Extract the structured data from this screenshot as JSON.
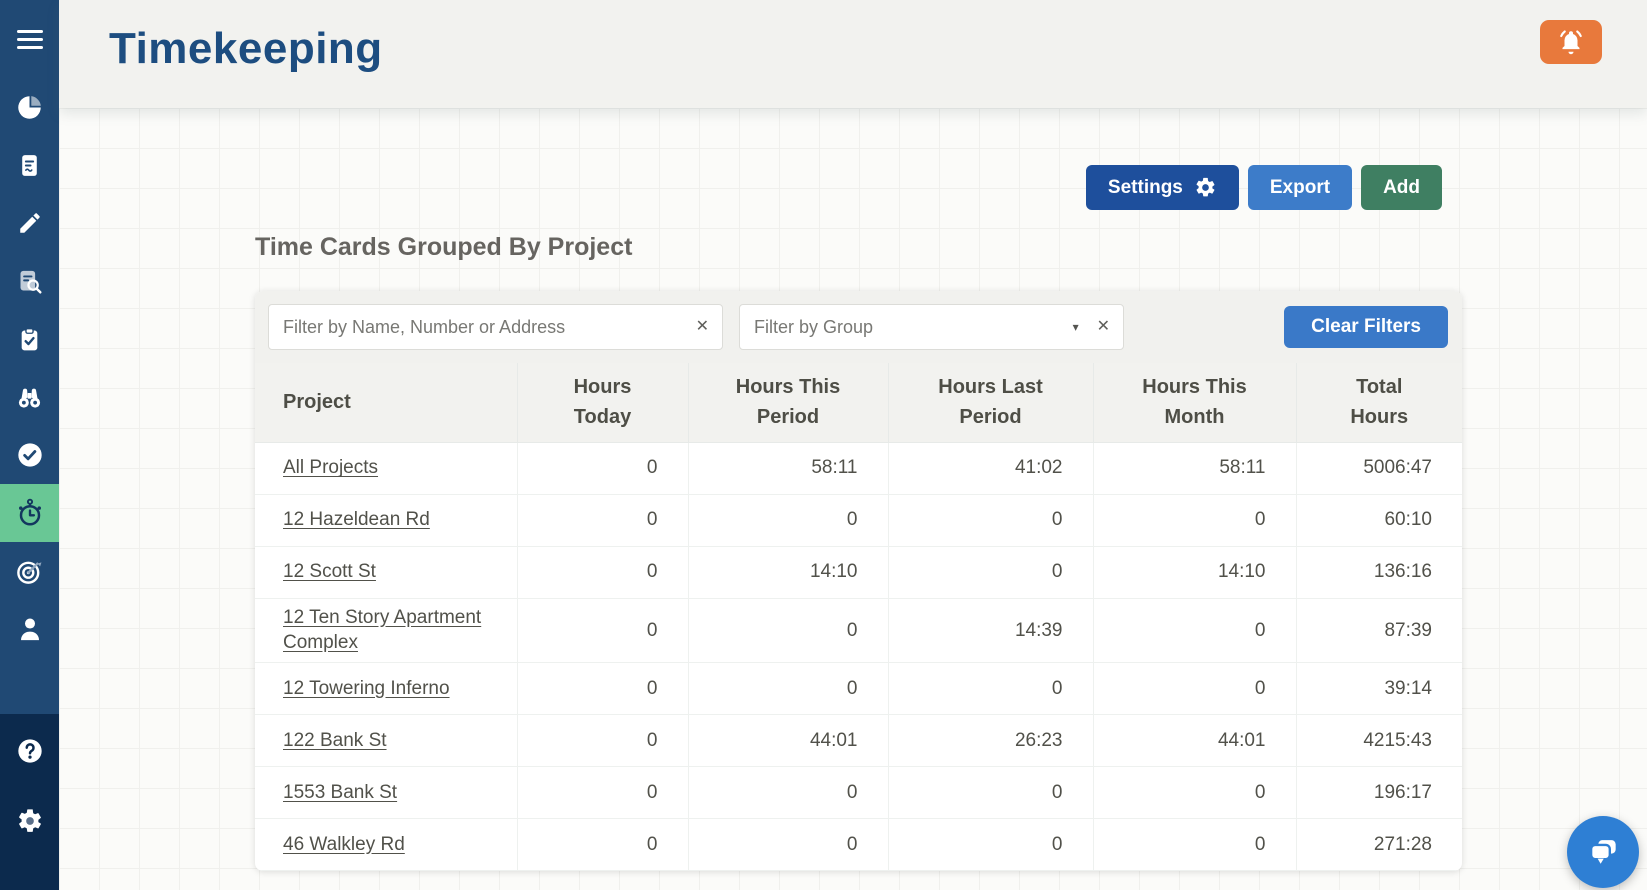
{
  "app": {
    "title": "Timekeeping"
  },
  "header": {
    "bell_icon": "bell-icon",
    "bell_color": "#e8793c"
  },
  "sidebar": {
    "background": "#204974",
    "bottom_background": "#0c2a4d",
    "active_background": "#69c795",
    "items": [
      {
        "icon": "hamburger-icon",
        "active": false
      },
      {
        "icon": "pie-chart-icon",
        "active": false
      },
      {
        "icon": "document-icon",
        "active": false
      },
      {
        "icon": "pencil-icon",
        "active": false
      },
      {
        "icon": "document-search-icon",
        "active": false
      },
      {
        "icon": "clipboard-check-icon",
        "active": false
      },
      {
        "icon": "binoculars-icon",
        "active": false
      },
      {
        "icon": "check-circle-icon",
        "active": false
      },
      {
        "icon": "stopwatch-icon",
        "active": true
      },
      {
        "icon": "target-icon",
        "active": false
      },
      {
        "icon": "person-icon",
        "active": false
      },
      {
        "icon": "help-icon",
        "active": false
      },
      {
        "icon": "gear-icon",
        "active": false
      }
    ]
  },
  "toolbar": {
    "settings_label": "Settings",
    "export_label": "Export",
    "add_label": "Add",
    "settings_color": "#1e4f9c",
    "export_color": "#3d7cc9",
    "add_color": "#3f7f62"
  },
  "page": {
    "title": "Time Cards Grouped By Project"
  },
  "filters": {
    "name_placeholder": "Filter by Name, Number or Address",
    "name_value": "",
    "group_placeholder": "Filter by Group",
    "group_value": "",
    "clear_button_label": "Clear Filters",
    "clear_button_color": "#3a79c8"
  },
  "icons": {
    "clear_x": "✕",
    "dropdown_arrow": "▾"
  },
  "table": {
    "columns": [
      {
        "l1": "Project",
        "l2": ""
      },
      {
        "l1": "Hours",
        "l2": "Today"
      },
      {
        "l1": "Hours This",
        "l2": "Period"
      },
      {
        "l1": "Hours Last",
        "l2": "Period"
      },
      {
        "l1": "Hours This",
        "l2": "Month"
      },
      {
        "l1": "Total",
        "l2": "Hours"
      }
    ],
    "rows": [
      {
        "project": "All Projects",
        "hours_today": "0",
        "hours_this_period": "58:11",
        "hours_last_period": "41:02",
        "hours_this_month": "58:11",
        "total_hours": "5006:47"
      },
      {
        "project": "12 Hazeldean Rd",
        "hours_today": "0",
        "hours_this_period": "0",
        "hours_last_period": "0",
        "hours_this_month": "0",
        "total_hours": "60:10"
      },
      {
        "project": "12 Scott St",
        "hours_today": "0",
        "hours_this_period": "14:10",
        "hours_last_period": "0",
        "hours_this_month": "14:10",
        "total_hours": "136:16"
      },
      {
        "project": "12 Ten Story Apartment Complex",
        "hours_today": "0",
        "hours_this_period": "0",
        "hours_last_period": "14:39",
        "hours_this_month": "0",
        "total_hours": "87:39"
      },
      {
        "project": "12 Towering Inferno",
        "hours_today": "0",
        "hours_this_period": "0",
        "hours_last_period": "0",
        "hours_this_month": "0",
        "total_hours": "39:14"
      },
      {
        "project": "122 Bank St",
        "hours_today": "0",
        "hours_this_period": "44:01",
        "hours_last_period": "26:23",
        "hours_this_month": "44:01",
        "total_hours": "4215:43"
      },
      {
        "project": "1553 Bank St",
        "hours_today": "0",
        "hours_this_period": "0",
        "hours_last_period": "0",
        "hours_this_month": "0",
        "total_hours": "196:17"
      },
      {
        "project": "46 Walkley Rd",
        "hours_today": "0",
        "hours_this_period": "0",
        "hours_last_period": "0",
        "hours_this_month": "0",
        "total_hours": "271:28"
      }
    ]
  },
  "chat": {
    "icon": "chat-bubbles-icon",
    "color": "#2e7fd4"
  }
}
